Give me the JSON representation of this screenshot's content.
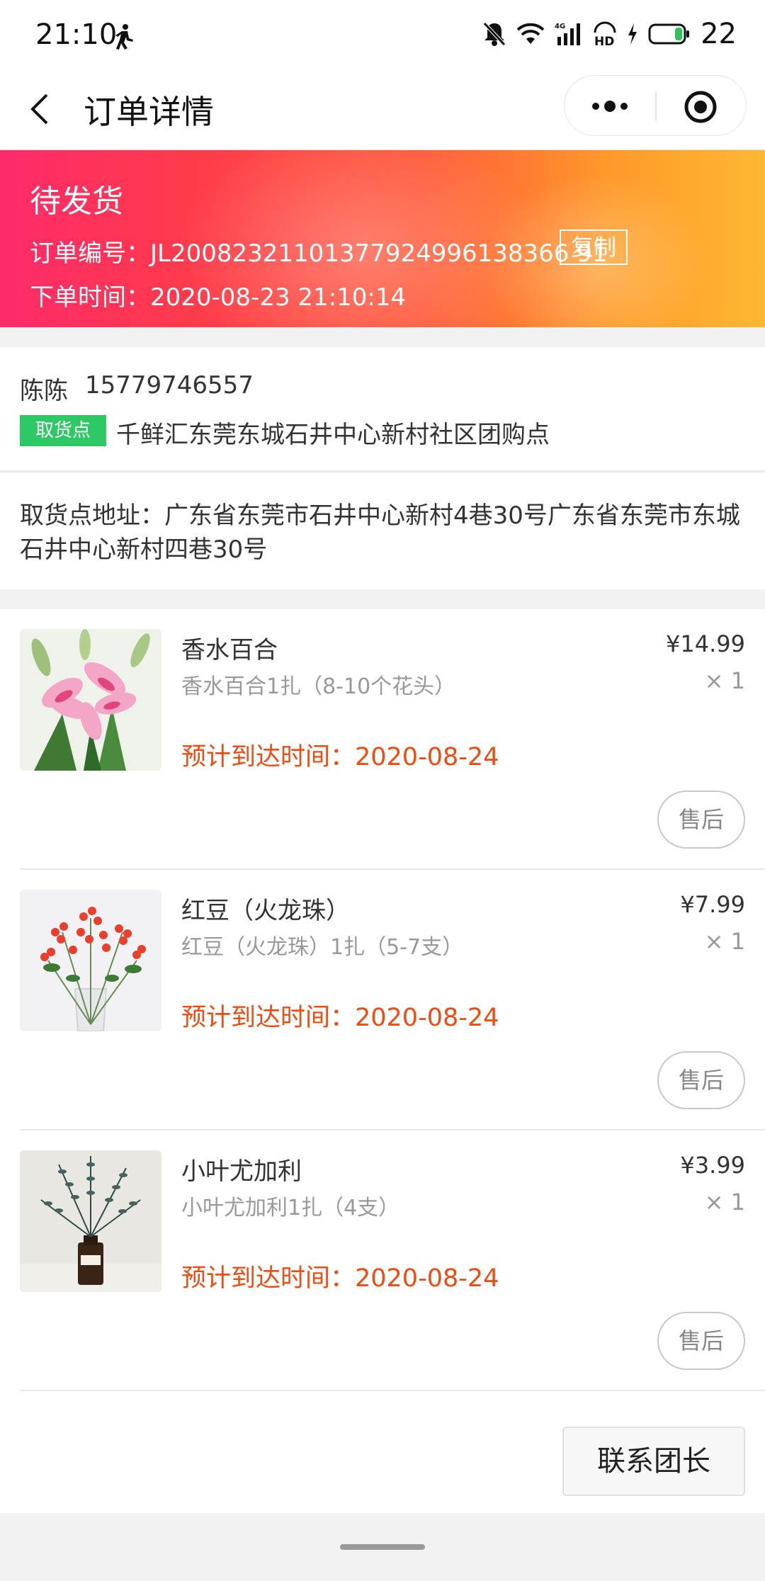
{
  "status_bar": {
    "time": "21:10",
    "battery": "22",
    "icons": [
      "walk-icon",
      "mute-icon",
      "wifi-icon",
      "signal-4g-icon",
      "hd-icon",
      "charging-icon",
      "battery-icon"
    ]
  },
  "nav": {
    "title": "订单详情",
    "icons": [
      "back-icon",
      "more-icon",
      "target-icon"
    ]
  },
  "banner": {
    "status": "待发货",
    "order_no": "订单编号：JL20082321101377924996138366 91",
    "copy_label": "复制",
    "order_time": "下单时间：2020-08-23 21:10:14"
  },
  "contact": {
    "name": "陈陈",
    "phone": "15779746557",
    "pickup_tag": "取货点",
    "pickup_name": "千鲜汇东莞东城石井中心新村社区团购点"
  },
  "address": {
    "text": "取货点地址：广东省东莞市石井中心新村4巷30号广东省东莞市东城石井中心新村四巷30号"
  },
  "products": [
    {
      "title": "香水百合",
      "spec": "香水百合1扎（8-10个花头）",
      "price": "¥14.99",
      "qty": "× 1",
      "eta": "预计到达时间：2020-08-24",
      "aftersale": "售后"
    },
    {
      "title": "红豆（火龙珠）",
      "spec": "红豆（火龙珠）1扎（5-7支）",
      "price": "¥7.99",
      "qty": "× 1",
      "eta": "预计到达时间：2020-08-24",
      "aftersale": "售后"
    },
    {
      "title": "小叶尤加利",
      "spec": "小叶尤加利1扎（4支）",
      "price": "¥3.99",
      "qty": "× 1",
      "eta": "预计到达时间：2020-08-24",
      "aftersale": "售后"
    }
  ],
  "footer": {
    "contact_leader": "联系团长"
  },
  "colors": {
    "eta": "#f34a10",
    "pickup_tag": "#2ec964",
    "banner_start": "#ff2a6a",
    "banner_end": "#ffb733"
  }
}
